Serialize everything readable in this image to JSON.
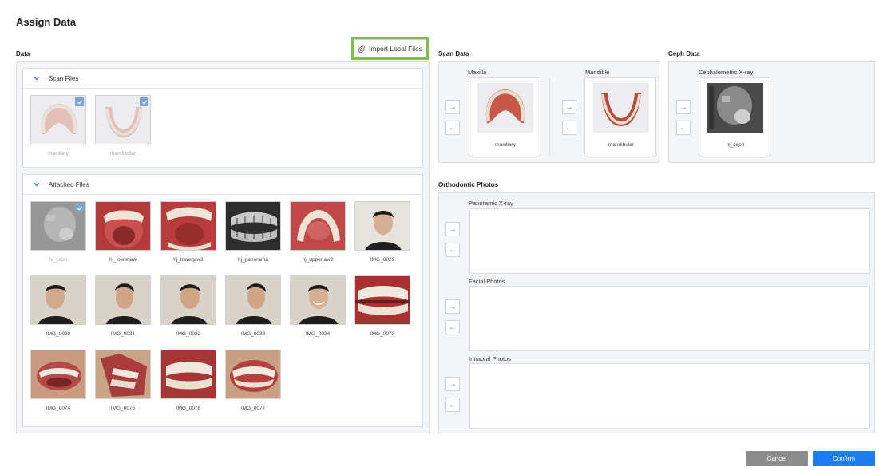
{
  "title": "Assign Data",
  "left": {
    "section_label": "Data",
    "import_button": "Import Local Files",
    "scan_files": {
      "header": "Scan Files",
      "items": [
        {
          "label": "maxillary",
          "checked": true
        },
        {
          "label": "mandibular",
          "checked": true
        }
      ]
    },
    "attached_files": {
      "header": "Attached Files",
      "items": [
        {
          "label": "hj_ceph",
          "checked": true
        },
        {
          "label": "hj_lowerjaw"
        },
        {
          "label": "hj_lowerjaw2"
        },
        {
          "label": "hj_panorama"
        },
        {
          "label": "hj_upperjaw2"
        },
        {
          "label": "IMG_0029"
        },
        {
          "label": "IMG_0030"
        },
        {
          "label": "IMG_0031"
        },
        {
          "label": "IMG_0032"
        },
        {
          "label": "IMG_0033"
        },
        {
          "label": "IMG_0034"
        },
        {
          "label": "IMG_0073"
        },
        {
          "label": "IMG_0074"
        },
        {
          "label": "IMG_0075"
        },
        {
          "label": "IMG_0076"
        },
        {
          "label": "IMG_0077"
        }
      ]
    }
  },
  "scan_data": {
    "section_label": "Scan Data",
    "maxilla": {
      "title": "Maxilla",
      "file": "maxillary"
    },
    "mandible": {
      "title": "Mandible",
      "file": "mandibular"
    }
  },
  "ceph_data": {
    "section_label": "Ceph Data",
    "ceph": {
      "title": "Cephalometric X-ray",
      "file": "hj_ceph"
    }
  },
  "ortho": {
    "section_label": "Orthodontic Photos",
    "panoramic": "Panoramic X-ray",
    "facial": "Facial Photos",
    "intraoral": "Intraoral Photos"
  },
  "footer": {
    "cancel": "Cancel",
    "confirm": "Confirm"
  },
  "colors": {
    "accent": "#1e7cf2",
    "highlight": "#7dc04a",
    "check": "#7ea3d8"
  }
}
